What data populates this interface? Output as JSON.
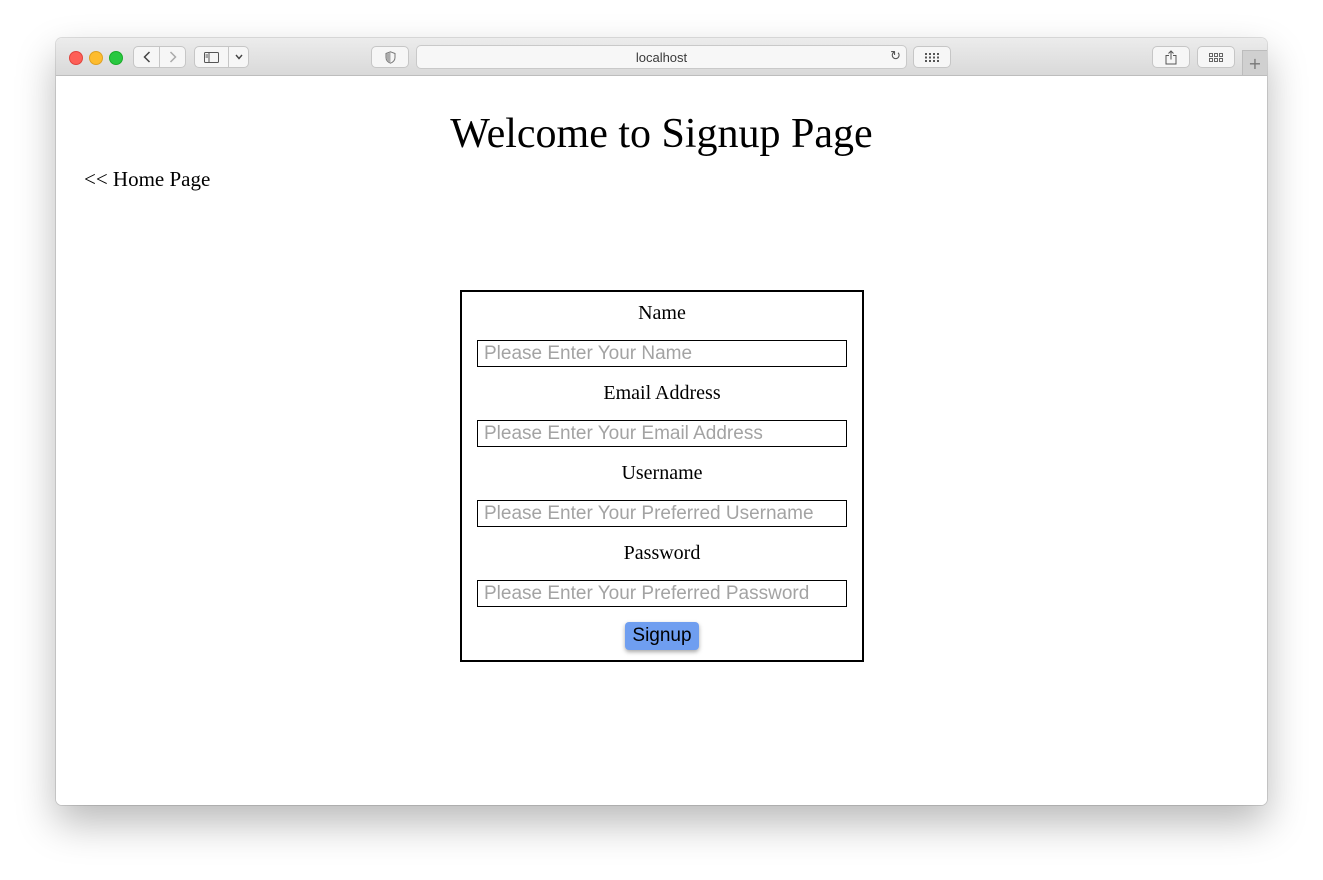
{
  "browser": {
    "address": "localhost",
    "icons": {
      "back": "chevron-left-icon",
      "forward": "chevron-right-icon",
      "sidebar": "sidebar-icon",
      "shield": "shield-icon",
      "reload": "reload-icon",
      "grid": "grid-icon",
      "share": "share-icon",
      "tabs": "tabs-overview-icon",
      "new_tab": "plus-icon"
    }
  },
  "page": {
    "title": "Welcome to Signup Page",
    "home_link": "<< Home Page"
  },
  "form": {
    "name_label": "Name",
    "name_placeholder": "Please Enter Your Name",
    "email_label": "Email Address",
    "email_placeholder": "Please Enter Your Email Address",
    "username_label": "Username",
    "username_placeholder": "Please Enter Your Preferred Username",
    "password_label": "Password",
    "password_placeholder": "Please Enter Your Preferred Password",
    "submit_label": "Signup",
    "submit_color": "#6f9ef0"
  }
}
